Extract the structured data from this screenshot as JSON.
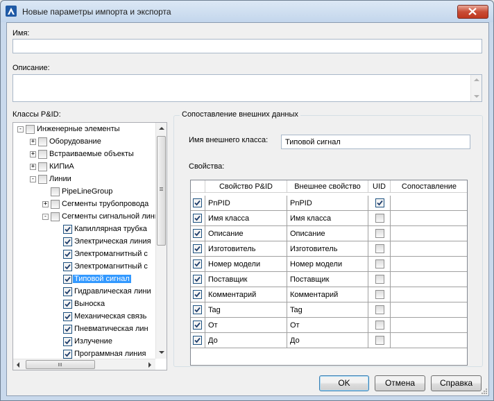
{
  "window": {
    "title": "Новые параметры импорта и экспорта"
  },
  "name": {
    "label": "Имя:",
    "value": ""
  },
  "description": {
    "label": "Описание:",
    "value": ""
  },
  "classes": {
    "label": "Классы P&ID:",
    "tree": [
      {
        "label": "Инженерные элементы",
        "expander": "minus",
        "checked": false,
        "level": 0
      },
      {
        "label": "Оборудование",
        "expander": "plus",
        "checked": false,
        "level": 1
      },
      {
        "label": "Встраиваемые объекты",
        "expander": "plus",
        "checked": false,
        "level": 1
      },
      {
        "label": "КИПиА",
        "expander": "plus",
        "checked": false,
        "level": 1
      },
      {
        "label": "Линии",
        "expander": "minus",
        "checked": false,
        "level": 1
      },
      {
        "label": "PipeLineGroup",
        "expander": "none",
        "checked": false,
        "level": 2
      },
      {
        "label": "Сегменты трубопровода",
        "expander": "plus",
        "checked": false,
        "level": 2
      },
      {
        "label": "Сегменты сигнальной линии",
        "expander": "minus",
        "checked": false,
        "level": 2
      },
      {
        "label": "Капиллярная трубка",
        "expander": "none",
        "checked": true,
        "level": 3
      },
      {
        "label": "Электрическая линия",
        "expander": "none",
        "checked": true,
        "level": 3
      },
      {
        "label": "Электромагнитный с",
        "expander": "none",
        "checked": true,
        "level": 3
      },
      {
        "label": "Электромагнитный с",
        "expander": "none",
        "checked": true,
        "level": 3
      },
      {
        "label": "Типовой сигнал",
        "expander": "none",
        "checked": true,
        "level": 3,
        "selected": true
      },
      {
        "label": "Гидравлическая лини",
        "expander": "none",
        "checked": true,
        "level": 3
      },
      {
        "label": "Выноска",
        "expander": "none",
        "checked": true,
        "level": 3
      },
      {
        "label": "Механическая связь",
        "expander": "none",
        "checked": true,
        "level": 3
      },
      {
        "label": "Пневматическая лин",
        "expander": "none",
        "checked": true,
        "level": 3
      },
      {
        "label": "Излучение",
        "expander": "none",
        "checked": true,
        "level": 3
      },
      {
        "label": "Программная линия",
        "expander": "none",
        "checked": true,
        "level": 3
      }
    ]
  },
  "mapping": {
    "group_title": "Сопоставление внешних данных",
    "external_class_label": "Имя внешнего класса:",
    "external_class_value": "Типовой сигнал",
    "properties_label": "Свойства:",
    "columns": [
      "Свойство P&ID",
      "Внешнее свойство",
      "UID",
      "Сопоставление"
    ],
    "rows": [
      {
        "checked": true,
        "pid": "PnPID",
        "external": "PnPID",
        "uid": true,
        "mapping": ""
      },
      {
        "checked": true,
        "pid": "Имя класса",
        "external": "Имя класса",
        "uid": false,
        "mapping": ""
      },
      {
        "checked": true,
        "pid": "Описание",
        "external": "Описание",
        "uid": false,
        "mapping": ""
      },
      {
        "checked": true,
        "pid": "Изготовитель",
        "external": "Изготовитель",
        "uid": false,
        "mapping": ""
      },
      {
        "checked": true,
        "pid": "Номер модели",
        "external": "Номер модели",
        "uid": false,
        "mapping": ""
      },
      {
        "checked": true,
        "pid": "Поставщик",
        "external": "Поставщик",
        "uid": false,
        "mapping": ""
      },
      {
        "checked": true,
        "pid": "Комментарий",
        "external": "Комментарий",
        "uid": false,
        "mapping": ""
      },
      {
        "checked": true,
        "pid": "Tag",
        "external": "Tag",
        "uid": false,
        "mapping": ""
      },
      {
        "checked": true,
        "pid": "От",
        "external": "От",
        "uid": false,
        "mapping": ""
      },
      {
        "checked": true,
        "pid": "До",
        "external": "До",
        "uid": false,
        "mapping": ""
      }
    ]
  },
  "buttons": {
    "ok": "OK",
    "cancel": "Отмена",
    "help": "Справка"
  },
  "colors": {
    "selection": "#3399ff",
    "title_bar": "#c3d6ec",
    "close_button": "#c94c35"
  }
}
